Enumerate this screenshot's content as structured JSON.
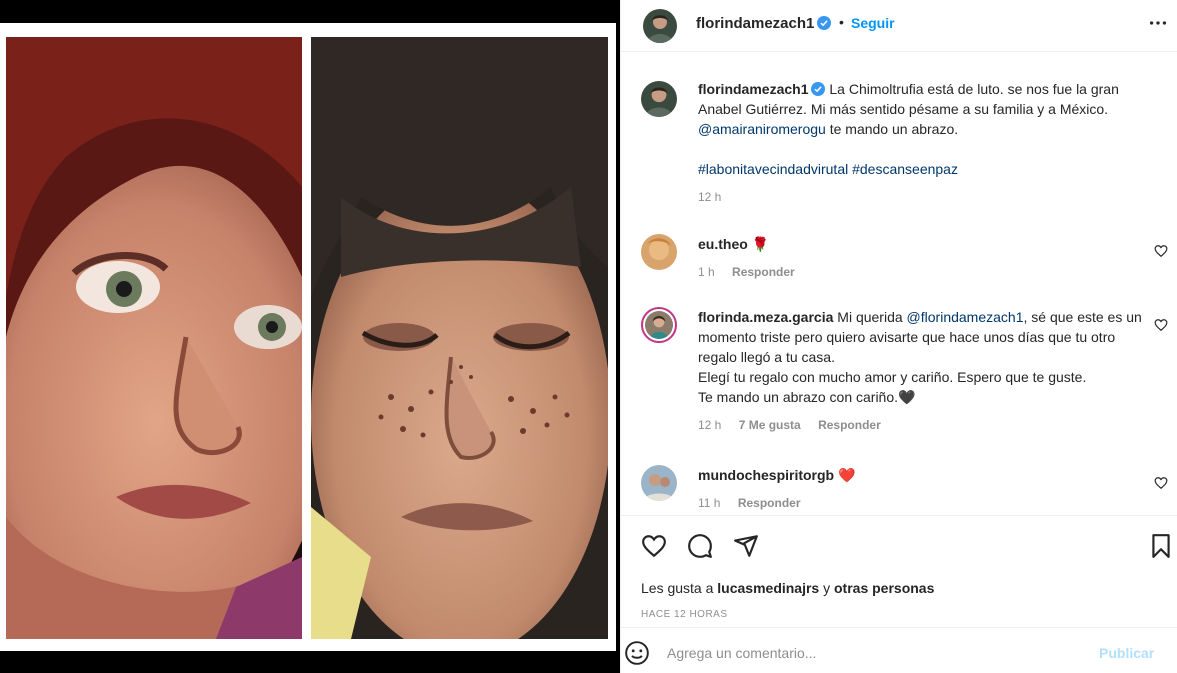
{
  "post": {
    "username": "florindamezach1",
    "separator": "•",
    "follow_label": "Seguir"
  },
  "caption": {
    "username": "florindamezach1",
    "text_1": "La Chimoltrufia está de luto. se nos fue la gran Anabel Gutiérrez. Mi más sentido pésame a su familia y a México. ",
    "mention": "@amairaniromerogu",
    "text_2": " te mando un abrazo.",
    "hashtag_1": "#labonitavecindadvirutal",
    "hashtag_2": "#descanseenpaz",
    "time": "12 h"
  },
  "comments": [
    {
      "username": "eu.theo",
      "emoji": "🌹",
      "time": "1 h",
      "reply_label": "Responder"
    },
    {
      "username": "florinda.meza.garcia",
      "text_1": "Mi querida ",
      "mention": "@florindamezach1",
      "text_2": ", sé que este es un momento triste pero quiero avisarte que hace unos días que tu otro regalo llegó a tu casa.",
      "text_3": "Elegí tu regalo con mucho amor y cariño. Espero que te guste.",
      "text_4": "Te mando un abrazo con cariño.🖤",
      "time": "12 h",
      "likes_label": "7 Me gusta",
      "reply_label": "Responder"
    },
    {
      "username": "mundochespiritorgb",
      "emoji": "❤️",
      "time": "11 h",
      "reply_label": "Responder"
    }
  ],
  "footer": {
    "likes_prefix": "Les gusta a ",
    "likes_user": "lucasmedinajrs",
    "likes_mid": " y ",
    "likes_suffix": "otras personas",
    "timestamp": "HACE 12 HORAS",
    "comment_placeholder": "Agrega un comentario...",
    "publish_label": "Publicar"
  },
  "colors": {
    "link_blue": "#0095f6",
    "mention_blue": "#00376b",
    "publish_disabled": "#b2dffc",
    "muted_text": "#8e8e8e"
  },
  "icons": [
    "verified-badge-icon",
    "more-options-icon",
    "heart-icon",
    "comment-icon",
    "share-icon",
    "bookmark-icon",
    "emoji-icon"
  ]
}
